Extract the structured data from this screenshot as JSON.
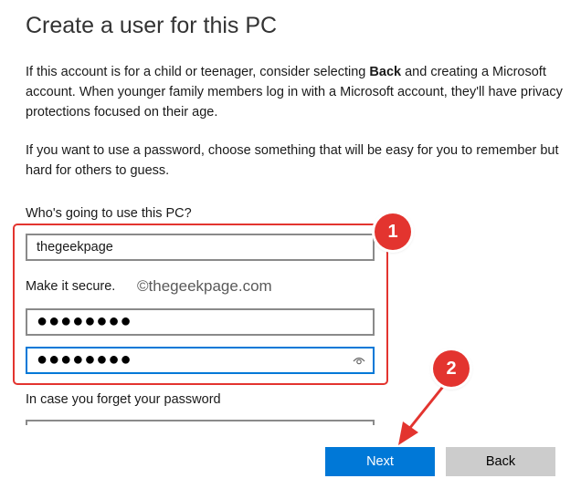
{
  "header": {
    "title": "Create a user for this PC"
  },
  "info": {
    "para1_before_bold": "If this account is for a child or teenager, consider selecting ",
    "para1_bold": "Back",
    "para1_after_bold": " and creating a Microsoft account. When younger family members log in with a Microsoft account, they'll have privacy protections focused on their age.",
    "para2": "If you want to use a password, choose something that will be easy for you to remember but hard for others to guess."
  },
  "form": {
    "username_label": "Who's going to use this PC?",
    "username_value": "thegeekpage",
    "password_label": "Make it secure.",
    "password_value": "●●●●●●●●",
    "confirm_value": "●●●●●●●●",
    "hint_label": "In case you forget your password"
  },
  "annotations": {
    "watermark": "©thegeekpage.com",
    "step1": "1",
    "step2": "2",
    "color": "#e3342f"
  },
  "buttons": {
    "next": "Next",
    "back": "Back"
  },
  "colors": {
    "accent": "#0078d7",
    "back_button": "#cccccc"
  }
}
